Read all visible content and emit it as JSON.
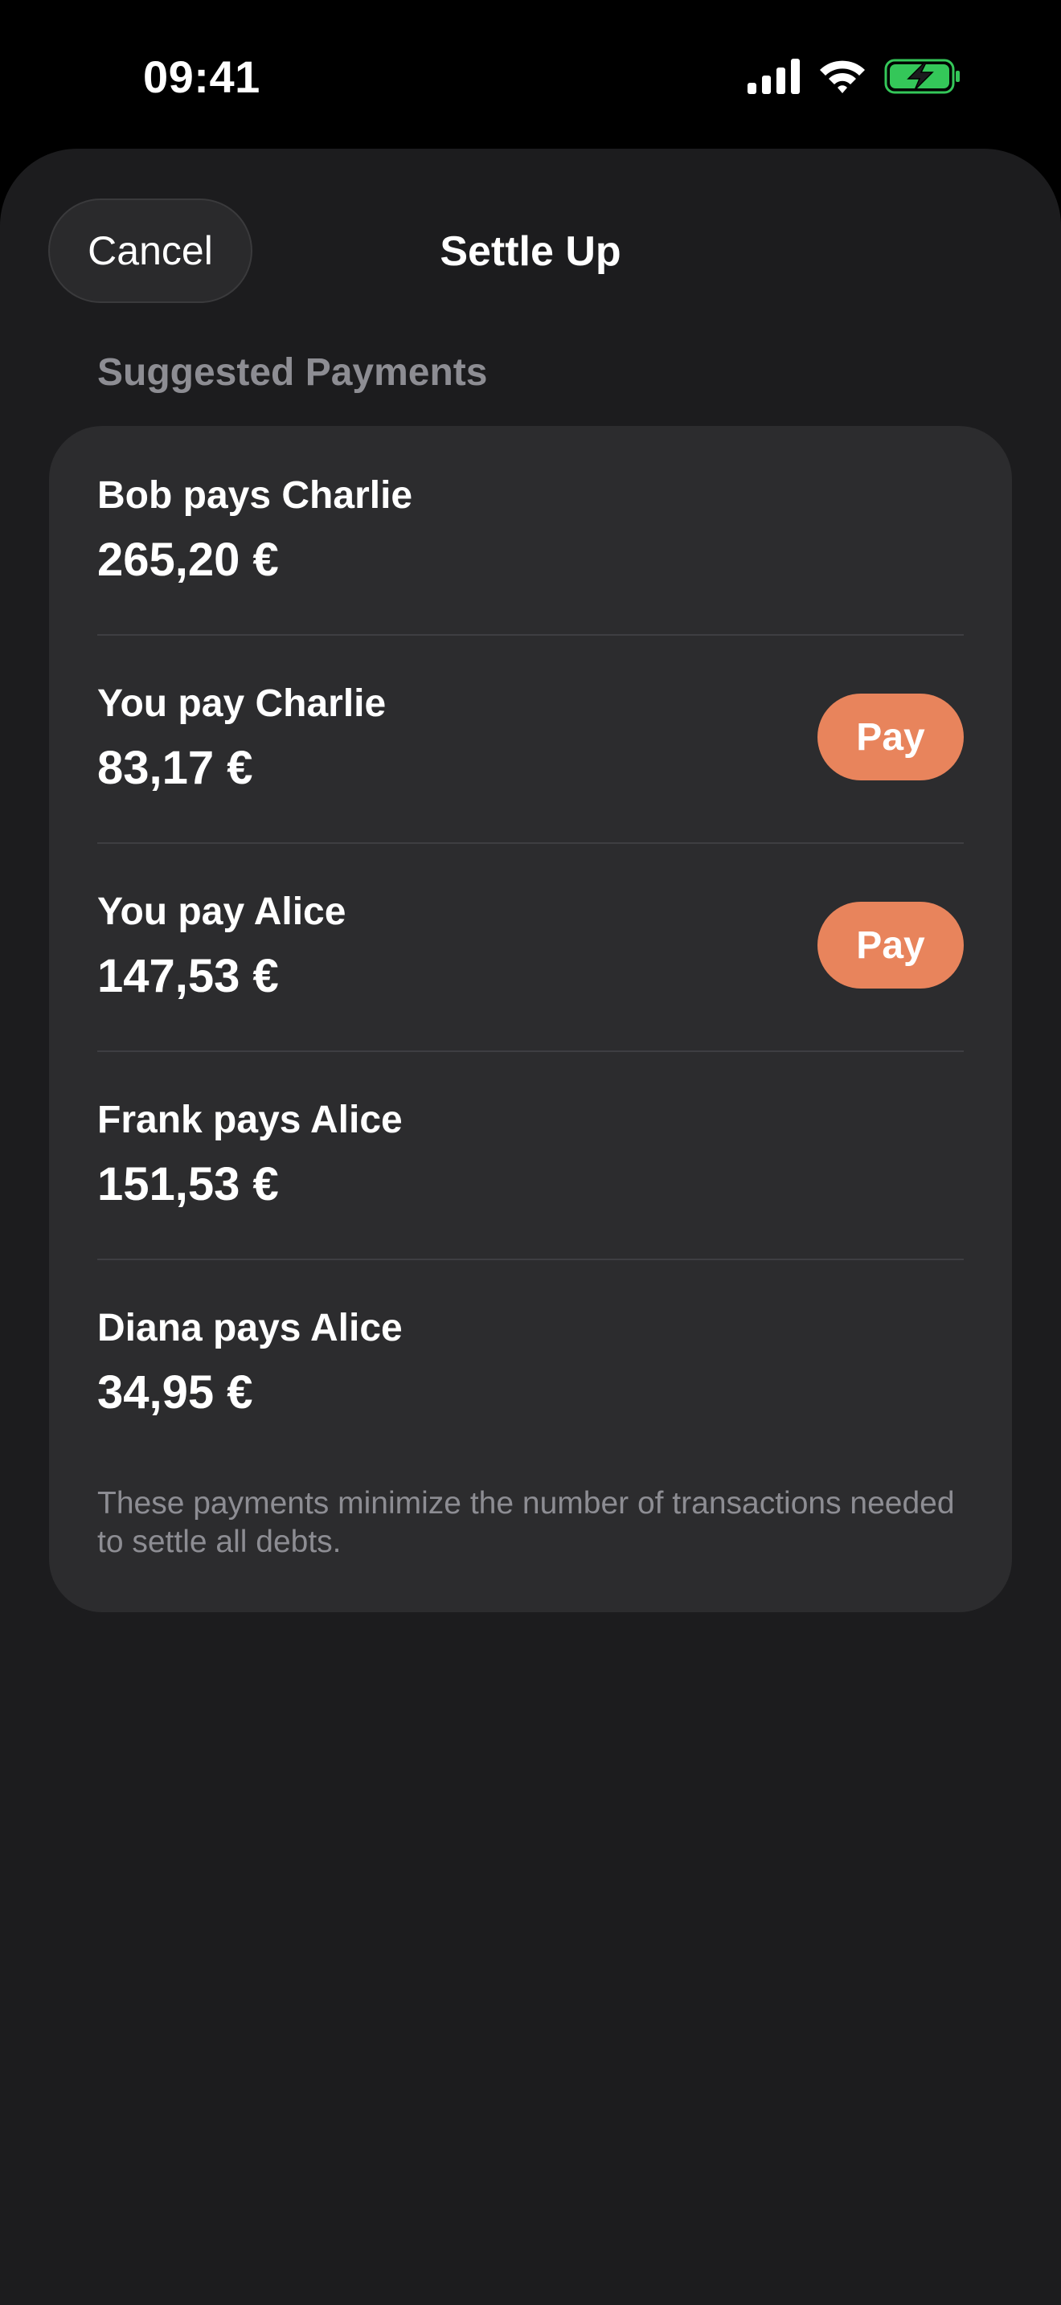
{
  "status_bar": {
    "time": "09:41",
    "icons": [
      "cellular-signal-icon",
      "wifi-icon",
      "battery-charging-icon"
    ]
  },
  "sheet": {
    "cancel_label": "Cancel",
    "title": "Settle Up",
    "section_header": "Suggested Payments",
    "payments": [
      {
        "description": "Bob pays Charlie",
        "amount": "265,20 €",
        "pay_label": ""
      },
      {
        "description": "You pay Charlie",
        "amount": "83,17 €",
        "pay_label": "Pay"
      },
      {
        "description": "You pay Alice",
        "amount": "147,53 €",
        "pay_label": "Pay"
      },
      {
        "description": "Frank pays Alice",
        "amount": "151,53 €",
        "pay_label": ""
      },
      {
        "description": "Diana pays Alice",
        "amount": "34,95 €",
        "pay_label": ""
      }
    ],
    "footer_note": "These payments minimize the number of transactions needed to settle all debts."
  },
  "colors": {
    "background": "#000000",
    "sheet": "#1c1c1e",
    "card": "#2c2c2e",
    "accent": "#e8845c",
    "secondary_text": "#8d8d93",
    "battery_fill": "#34c759"
  }
}
